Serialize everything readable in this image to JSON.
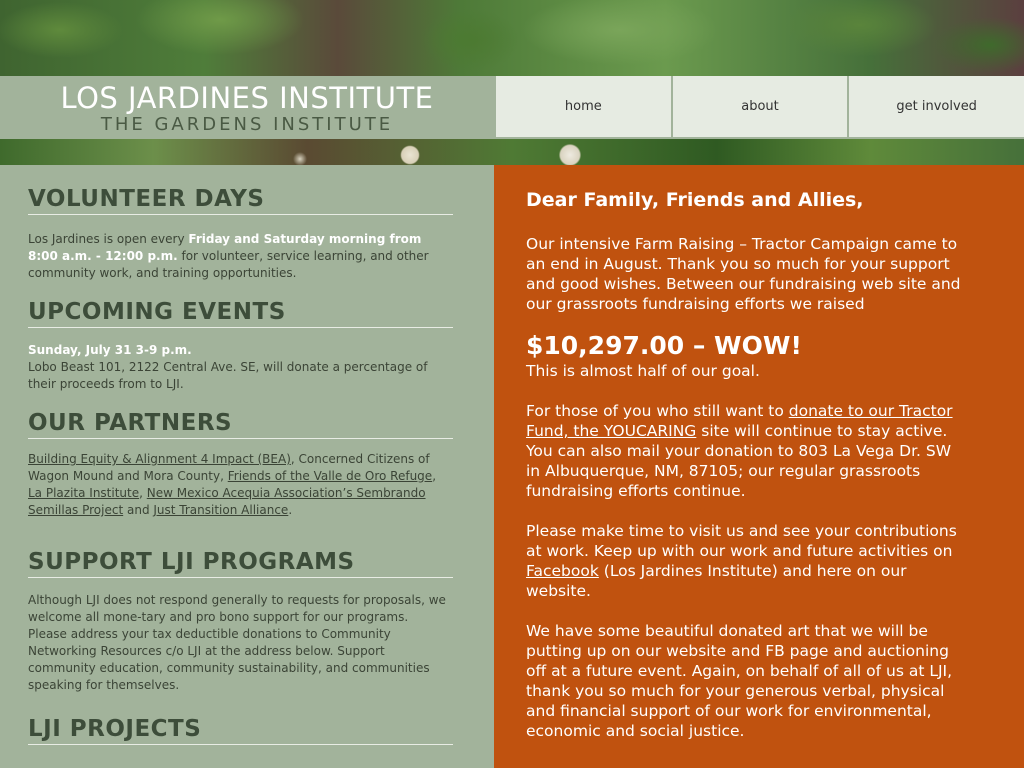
{
  "header": {
    "logo_title": "LOS JARDINES INSTITUTE",
    "logo_subtitle": "THE GARDENS INSTITUTE"
  },
  "nav": {
    "items": [
      {
        "label": "home"
      },
      {
        "label": "about"
      },
      {
        "label": "get involved"
      }
    ]
  },
  "left": {
    "volunteer": {
      "heading": "VOLUNTEER DAYS",
      "text_before": "Los Jardines is open every ",
      "highlight": "Friday and Saturday morning from 8:00 a.m. - 12:00 p.m.",
      "text_after": " for volunteer, service learning, and other community work, and training opportunities."
    },
    "events": {
      "heading": "UPCOMING EVENTS",
      "date": "Sunday, July 31 3-9 p.m.",
      "text": "Lobo Beast 101, 2122 Central Ave. SE, will donate a percentage of their proceeds from to LJI."
    },
    "partners": {
      "heading": "OUR PARTNERS",
      "link1": "Building Equity & Alignment 4 Impact (BEA)",
      "text1": ", Concerned Citizens of Wagon Mound and Mora County, ",
      "link2": "Friends of the Valle de Oro Refuge",
      "text2": ", ",
      "link3": "La Plazita Institute",
      "text3": ", ",
      "link4": "New Mexico Acequia Association’s Sembrando Semillas Project",
      "text4": " and ",
      "link5": "Just Transition Alliance",
      "text5": "."
    },
    "support": {
      "heading": "SUPPORT LJI PROGRAMS",
      "text": "Although LJI does not respond generally to requests for proposals, we welcome all mone-tary and pro bono support for our programs. Please address your tax deductible donations to Community Networking Resources c/o LJI at the address below. Support community education, community sustainability, and communities speaking for themselves."
    },
    "projects": {
      "heading": "LJI PROJECTS"
    }
  },
  "right": {
    "greeting": "Dear Family, Friends and Allies,",
    "p1": "Our intensive Farm Raising – Tractor Campaign came to an end in August. Thank you so much for your support and good wishes.  Between our fundraising web site and our grassroots fundraising efforts we raised",
    "amount": "$10,297.00 – WOW!",
    "half_goal": "This is almost half of our goal.",
    "p3_before": "For those of you who still want to ",
    "p3_link": "donate to our Tractor Fund, the YOUCARING",
    "p3_after": " site will continue to stay active. You can also mail your donation to 803 La Vega Dr. SW in Albuquerque, NM, 87105; our regular grassroots fundraising efforts continue.",
    "p4_before": "Please make time to visit us and see your contributions at work. Keep up with our work and future activities on ",
    "p4_link": "Facebook",
    "p4_after": " (Los Jardines Institute) and here on our website.",
    "p5": "We have some beautiful donated art that we will be putting up on our website and FB page and auctioning off at a future event. Again, on behalf of all of us at LJI, thank you so much for your generous verbal, physical and financial support of our work for environmental, economic and social justice."
  },
  "colors": {
    "sage": "#a2b39b",
    "orange": "#c0520f",
    "nav_bg": "#e6ebe2"
  }
}
